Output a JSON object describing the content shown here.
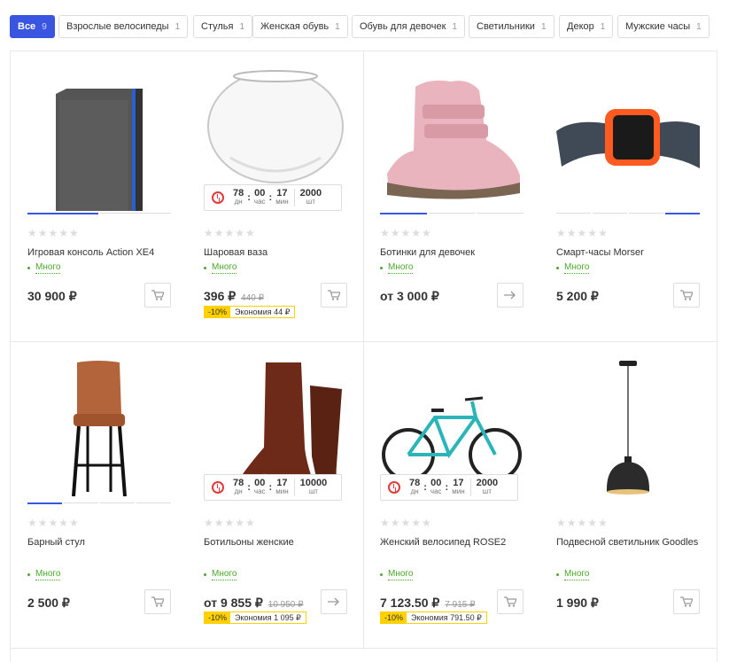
{
  "filter_tabs": [
    {
      "label": "Все",
      "count": "9",
      "active": true
    },
    {
      "label": "Взрослые велосипеды",
      "count": "1"
    },
    {
      "label": "Стулья",
      "count": "1"
    },
    {
      "label": "Женская обувь",
      "count": "1"
    },
    {
      "label": "Обувь для девочек",
      "count": "1"
    },
    {
      "label": "Светильники",
      "count": "1"
    },
    {
      "label": "Декор",
      "count": "1"
    },
    {
      "label": "Мужские часы",
      "count": "1"
    }
  ],
  "products": [
    {
      "name": "Игровая консоль Action XE4",
      "stock": "Много",
      "price": "30 900 ₽",
      "image_icon": "game-console-icon",
      "button_icon": "cart-icon",
      "active_slide": 0,
      "slides": 2
    },
    {
      "name": "Шаровая ваза",
      "stock": "Много",
      "price": "396 ₽",
      "old_price": "440 ₽",
      "discount": "-10%",
      "savings": "Экономия 44 ₽",
      "image_icon": "glass-vase-icon",
      "button_icon": "cart-icon",
      "timer": {
        "days": "78",
        "days_label": "дн",
        "hours": "00",
        "hours_label": "час",
        "mins": "17",
        "mins_label": "мин",
        "qty": "2000",
        "qty_label": "шт"
      }
    },
    {
      "name": "Ботинки для девочек",
      "stock": "Много",
      "price": "от 3 000 ₽",
      "image_icon": "boot-icon",
      "button_icon": "arrow-right-icon",
      "active_slide": 0,
      "slides": 3
    },
    {
      "name": "Смарт-часы Morser",
      "stock": "Много",
      "price": "5 200 ₽",
      "image_icon": "smartwatch-icon",
      "button_icon": "cart-icon",
      "active_slide": 3,
      "slides": 4
    },
    {
      "name": "Барный стул",
      "stock": "Много",
      "price": "2 500 ₽",
      "image_icon": "bar-stool-icon",
      "button_icon": "cart-icon",
      "active_slide": 0,
      "slides": 4
    },
    {
      "name": "Ботильоны женские",
      "stock": "Много",
      "price": "от 9 855 ₽",
      "old_price": "10 950 ₽",
      "discount": "-10%",
      "savings": "Экономия 1 095 ₽",
      "image_icon": "ankle-boots-icon",
      "button_icon": "arrow-right-icon",
      "timer": {
        "days": "78",
        "days_label": "дн",
        "hours": "00",
        "hours_label": "час",
        "mins": "17",
        "mins_label": "мин",
        "qty": "10000",
        "qty_label": "шт"
      }
    },
    {
      "name": "Женский велосипед ROSE2",
      "stock": "Много",
      "price": "7 123.50 ₽",
      "old_price": "7 915 ₽",
      "discount": "-10%",
      "savings": "Экономия 791.50 ₽",
      "image_icon": "bicycle-icon",
      "button_icon": "cart-icon",
      "timer": {
        "days": "78",
        "days_label": "дн",
        "hours": "00",
        "hours_label": "час",
        "mins": "17",
        "mins_label": "мин",
        "qty": "2000",
        "qty_label": "шт"
      }
    },
    {
      "name": "Подвесной светильник Goodles",
      "stock": "Много",
      "price": "1 990 ₽",
      "image_icon": "pendant-lamp-icon",
      "button_icon": "cart-icon"
    }
  ],
  "colors": {
    "accent": "#3a56e0",
    "stock": "#4aa82a",
    "discount": "#ffd100",
    "timer": "#e23a3a"
  },
  "rating_stars": "★★★★★"
}
